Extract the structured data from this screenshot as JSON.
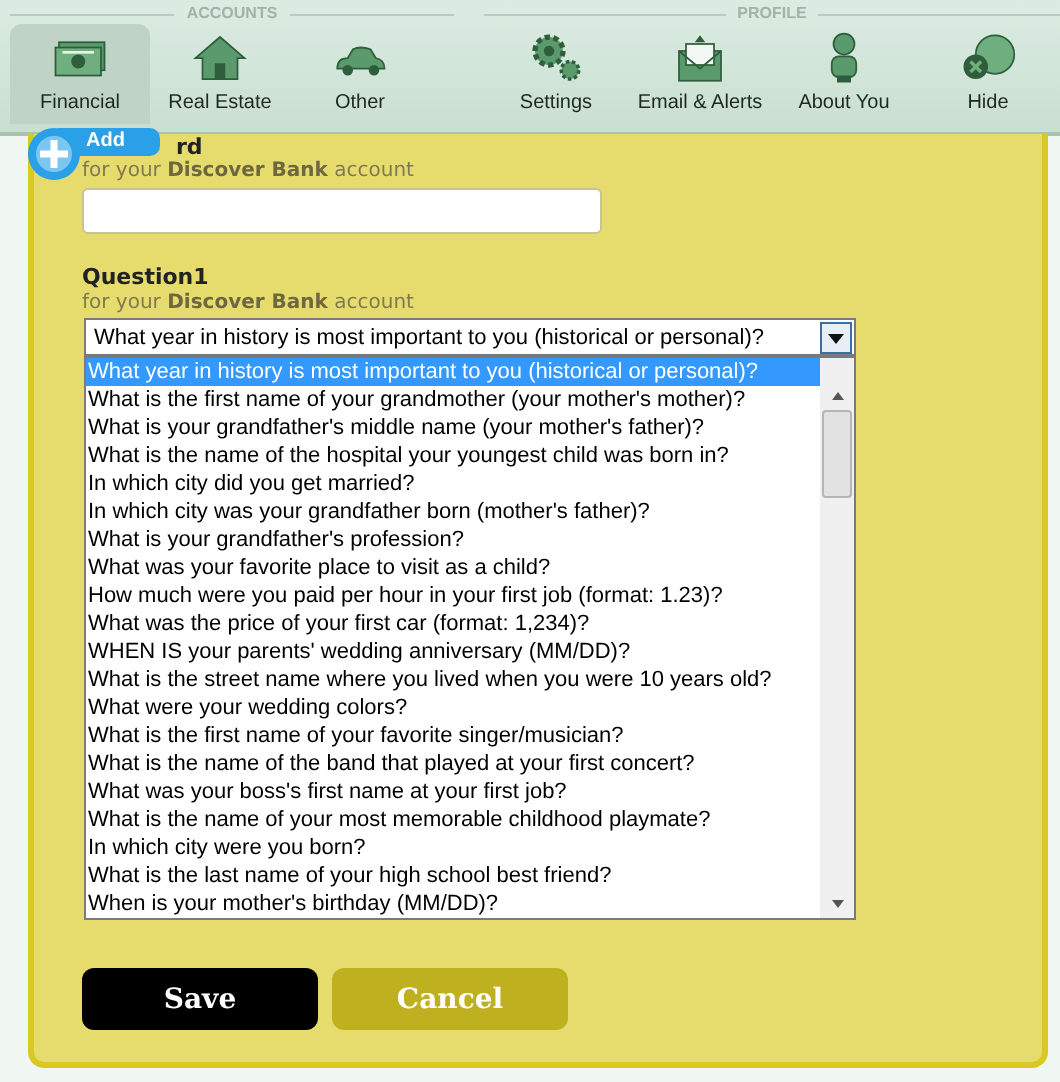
{
  "toolbar": {
    "groups": [
      {
        "title": "ACCOUNTS",
        "items": [
          {
            "label": "Financial",
            "selected": true
          },
          {
            "label": "Real Estate",
            "selected": false
          },
          {
            "label": "Other",
            "selected": false
          }
        ]
      },
      {
        "title": "PROFILE",
        "items": [
          {
            "label": "Settings",
            "selected": false
          },
          {
            "label": "Email & Alerts",
            "selected": false
          },
          {
            "label": "About You",
            "selected": false
          },
          {
            "label": "Hide",
            "selected": false
          }
        ]
      }
    ]
  },
  "add_badge": {
    "label": "Add"
  },
  "form": {
    "fields": [
      {
        "label": "rd",
        "subtitle": "for your **Discover Bank** account",
        "kind": "text"
      },
      {
        "label": "Question1",
        "subtitle": "for your **Discover Bank** account",
        "kind": "select",
        "value": "What year in history is most important to you (historical or personal)?",
        "options": [
          {
            "label": "What year in history is most important to you (historical or personal)?",
            "selected": true
          },
          {
            "label": "What is the first name of your grandmother (your mother's mother)?",
            "selected": false
          },
          {
            "label": "What is your grandfather's middle name (your mother's father)?",
            "selected": false
          },
          {
            "label": "What is the name of the hospital your youngest child was born in?",
            "selected": false
          },
          {
            "label": "In which city did you get married?",
            "selected": false
          },
          {
            "label": "In which city was your grandfather born (mother's father)?",
            "selected": false
          },
          {
            "label": "What is your grandfather's profession?",
            "selected": false
          },
          {
            "label": "What was your favorite place to visit as a child?",
            "selected": false
          },
          {
            "label": "How much were you paid per hour in your first job (format: 1.23)?",
            "selected": false
          },
          {
            "label": "What was the price of your first car (format: 1,234)?",
            "selected": false
          },
          {
            "label": "WHEN IS your parents' wedding anniversary (MM/DD)?",
            "selected": false
          },
          {
            "label": "What is the street name where you lived when you were 10 years old?",
            "selected": false
          },
          {
            "label": "What were your wedding colors?",
            "selected": false
          },
          {
            "label": "What is the first name of your favorite singer/musician?",
            "selected": false
          },
          {
            "label": "What is the name of the band that played at your first concert?",
            "selected": false
          },
          {
            "label": "What was your boss's first name at your first job?",
            "selected": false
          },
          {
            "label": "What is the name of your most memorable childhood playmate?",
            "selected": false
          },
          {
            "label": "In which city were you born?",
            "selected": false
          },
          {
            "label": "What is the last name of your high school best friend?",
            "selected": false
          },
          {
            "label": "When is your mother's birthday (MM/DD)?",
            "selected": false
          }
        ]
      }
    ]
  },
  "buttons": [
    {
      "label": "Save",
      "kind": "primary"
    },
    {
      "label": "Cancel",
      "kind": "secondary"
    }
  ]
}
